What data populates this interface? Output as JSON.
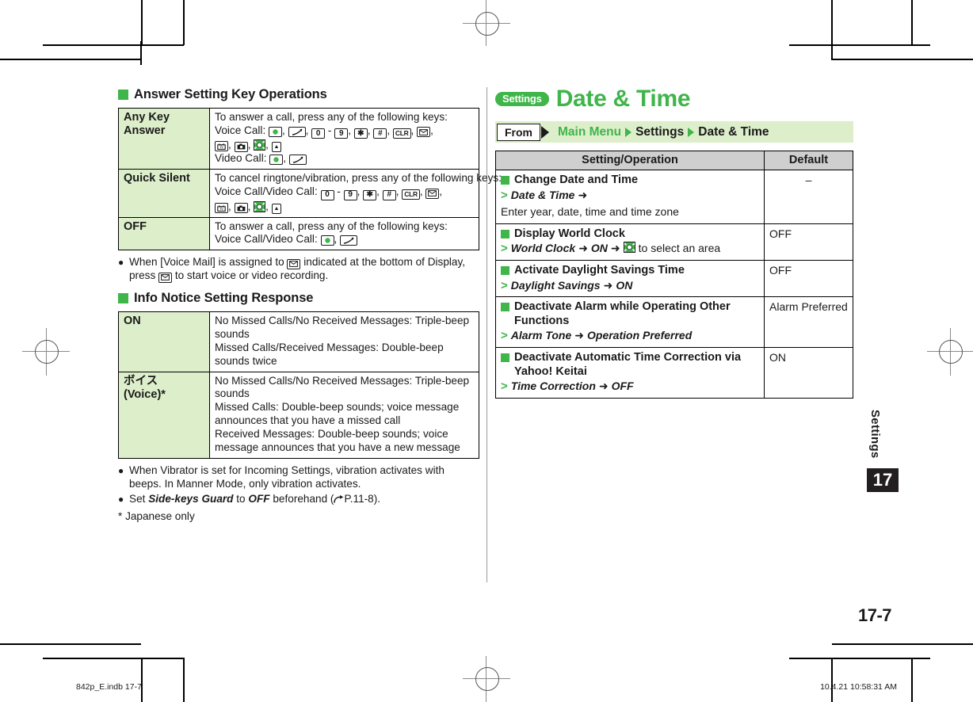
{
  "page": {
    "number": "17-7",
    "side_tab_label": "Settings",
    "side_tab_number": "17"
  },
  "footer": {
    "file": "842p_E.indb   17-7",
    "timestamp": "10.4.21   10:58:31 AM"
  },
  "left_column": {
    "section1": {
      "heading": "Answer Setting Key Operations",
      "rows": [
        {
          "label": "Any Key Answer",
          "line1": "To answer a call, press any of the following keys:",
          "line2_prefix": "Voice Call:",
          "line3_prefix": "Video Call:"
        },
        {
          "label": "Quick Silent",
          "line1": "To cancel ringtone/vibration, press any of the following keys:",
          "line2_prefix": "Voice Call/Video Call:"
        },
        {
          "label": "OFF",
          "line1": "To answer a call, press any of the following keys:",
          "line2_prefix": "Voice Call/Video Call:"
        }
      ]
    },
    "note1": {
      "bullet": "●",
      "part1": "When [Voice Mail] is assigned to",
      "part2": "indicated at the bottom of Display,",
      "part3": "press",
      "part4": "to start voice or video recording."
    },
    "section2": {
      "heading": "Info Notice Setting Response",
      "rows": [
        {
          "label": "ON",
          "lines": [
            "No Missed Calls/No Received Messages: Triple-beep sounds",
            "Missed Calls/Received Messages: Double-beep sounds twice"
          ]
        },
        {
          "label": "ボイス (Voice)*",
          "label_line1": "ボイス",
          "label_line2": "(Voice)*",
          "lines": [
            "No Missed Calls/No Received Messages: Triple-beep sounds",
            "Missed Calls: Double-beep sounds; voice message announces that you have a missed call",
            "Received Messages: Double-beep sounds; voice message announces that you have a new message"
          ]
        }
      ]
    },
    "notes2": [
      {
        "bullet": "●",
        "text": "When Vibrator is set for Incoming Settings, vibration activates with beeps. In Manner Mode, only vibration activates."
      }
    ],
    "note_sidekeys": {
      "bullet": "●",
      "prefix": "Set",
      "em1": "Side-keys Guard",
      "mid": "to",
      "em2": "OFF",
      "suffix": "beforehand (",
      "ref": "P.11-8",
      "close": ")."
    },
    "footnote": "* Japanese only"
  },
  "right_column": {
    "badge": "Settings",
    "title": "Date & Time",
    "breadcrumb": {
      "from_label": "From",
      "items": [
        "Main Menu",
        "Settings",
        "Date & Time"
      ]
    },
    "table": {
      "headers": [
        "Setting/Operation",
        "Default"
      ],
      "rows": [
        {
          "title": "Change Date and Time",
          "step_em": "Date & Time",
          "step_arrow": "➜",
          "step_rest": "Enter year, date, time and time zone",
          "default": "–",
          "default_center": true
        },
        {
          "title": "Display World Clock",
          "step_em": "World Clock",
          "step_arrow": "➜",
          "step_em2": "ON",
          "step_arrow2": "➜",
          "step_icon": "navigation-key-icon",
          "step_rest": "to select an area",
          "default": "OFF",
          "default_center": false
        },
        {
          "title": "Activate Daylight Savings Time",
          "step_em": "Daylight Savings",
          "step_arrow": "➜",
          "step_em2": "ON",
          "default": "OFF",
          "default_center": false
        },
        {
          "title": "Deactivate Alarm while Operating Other Functions",
          "step_em": "Alarm Tone",
          "step_arrow": "➜",
          "step_em2": "Operation Preferred",
          "default": "Alarm Preferred",
          "default_center": false
        },
        {
          "title": "Deactivate Automatic Time Correction via Yahoo! Keitai",
          "step_em": "Time Correction",
          "step_arrow": "➜",
          "step_em2": "OFF",
          "default": "ON",
          "default_center": false
        }
      ]
    }
  },
  "keys": {
    "center": "center-select-key-icon",
    "send": "send-call-key-icon",
    "zero": "0",
    "dash": "-",
    "nine": "9",
    "star": "✱",
    "hash": "#",
    "clr": "CLR",
    "mail": "mail-key-icon",
    "tv": "tv-key-icon",
    "camera": "camera-key-icon",
    "nav": "navigation-key-icon",
    "side": "side-key-icon"
  },
  "colors": {
    "brand_green": "#3fb54a",
    "pale_green": "#ddeecb",
    "header_gray": "#cfcfcf",
    "ink": "#1a1a1a"
  }
}
